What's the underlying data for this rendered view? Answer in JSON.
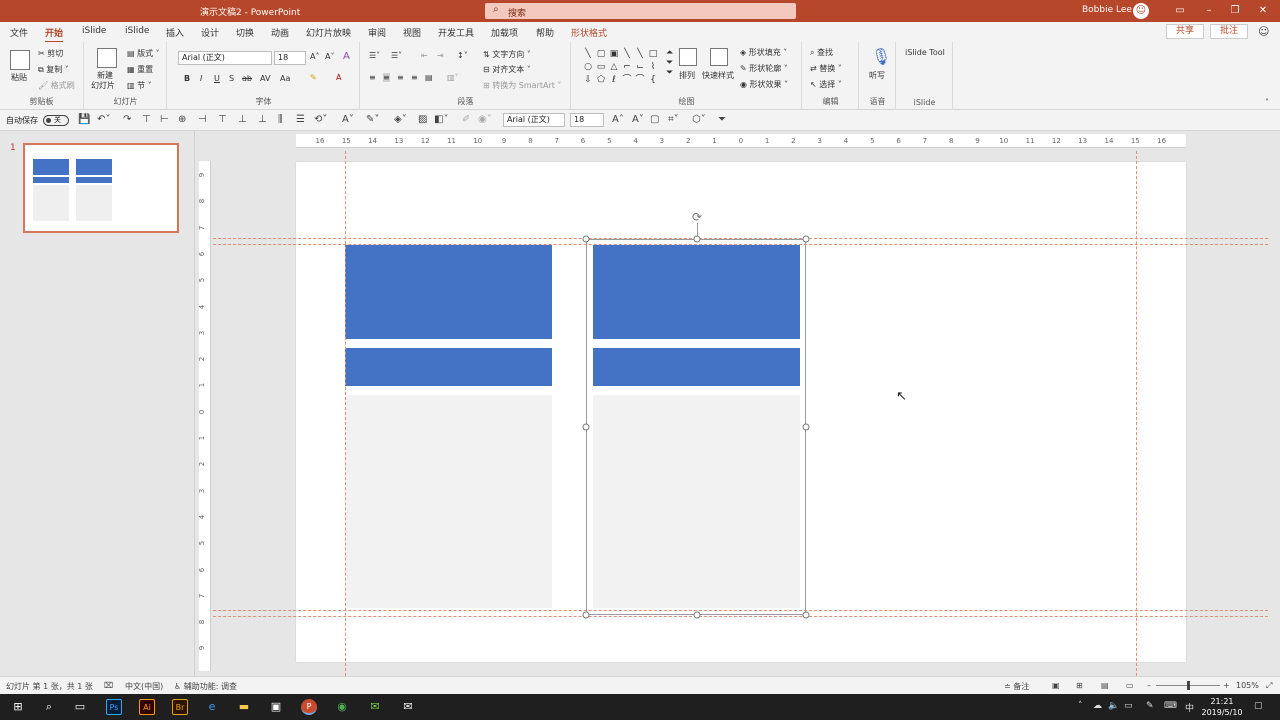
{
  "titlebar": {
    "doc_title": "演示文稿2 - PowerPoint",
    "search_placeholder": "搜索",
    "user": "Bobbie Lee"
  },
  "tabs": [
    "文件",
    "开始",
    "iSlide",
    "iSlide",
    "插入",
    "设计",
    "切换",
    "动画",
    "幻灯片放映",
    "审阅",
    "视图",
    "开发工具",
    "加载项",
    "帮助",
    "形状格式"
  ],
  "share_label": "共享",
  "comment_label": "批注",
  "ribbon": {
    "clipboard": {
      "paste": "粘贴",
      "cut": "剪切",
      "copy": "复制",
      "format_painter": "格式刷",
      "label": "剪贴板"
    },
    "slides": {
      "new_slide": "新建",
      "new_slide2": "幻灯片",
      "layout": "版式",
      "reset": "重置",
      "section": "节",
      "label": "幻灯片"
    },
    "font": {
      "name": "Arial (正文)",
      "size": "18",
      "label": "字体",
      "bold": "B",
      "italic": "I",
      "underline": "U",
      "strike": "S",
      "shadow": "ab",
      "spacing": "AV",
      "case": "Aa",
      "grow": "A˄",
      "shrink": "A˅"
    },
    "paragraph": {
      "text_direction": "文字方向",
      "align_text": "对齐文本",
      "smartart": "转换为 SmartArt",
      "label": "段落"
    },
    "drawing": {
      "arrange": "排列",
      "quick_styles": "快速样式",
      "fill": "形状填充",
      "outline": "形状轮廓",
      "effects": "形状效果",
      "label": "绘图"
    },
    "editing": {
      "find": "查找",
      "replace": "替换",
      "select": "选择",
      "label": "编辑"
    },
    "voice": {
      "dictate": "听写",
      "label": "语音"
    },
    "islide": {
      "tool": "iSlide Tool",
      "label": "iSlide"
    }
  },
  "qat": {
    "autosave": "自动保存",
    "toggle": "关",
    "font_name": "Arial (正文)",
    "font_size": "18"
  },
  "thumb": {
    "number": "1"
  },
  "hruler_ticks": [
    "16",
    "15",
    "14",
    "13",
    "12",
    "11",
    "10",
    "9",
    "8",
    "7",
    "6",
    "5",
    "4",
    "3",
    "2",
    "1",
    "0",
    "1",
    "2",
    "3",
    "4",
    "5",
    "6",
    "7",
    "8",
    "9",
    "10",
    "11",
    "12",
    "13",
    "14",
    "15",
    "16"
  ],
  "vruler_ticks": [
    "9",
    "8",
    "7",
    "6",
    "5",
    "4",
    "3",
    "2",
    "1",
    "0",
    "1",
    "2",
    "3",
    "4",
    "5",
    "6",
    "7",
    "8",
    "9"
  ],
  "status": {
    "slide_info": "幻灯片 第 1 张，共 1 张",
    "language": "中文(中国)",
    "accessibility": "辅助功能: 调查",
    "notes": "备注",
    "zoom": "105%"
  },
  "taskbar": {
    "time": "21:21",
    "date": "2019/5/10",
    "ime": "中"
  },
  "colors": {
    "accent": "#b7472a",
    "shape_blue": "#4472c4",
    "shape_gray": "#f2f2f2",
    "guide": "#e88c75"
  }
}
